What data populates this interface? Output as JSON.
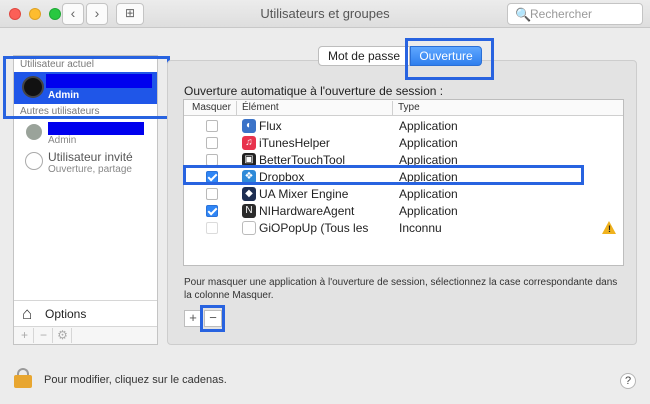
{
  "window": {
    "title": "Utilisateurs et groupes",
    "nav_back": "‹",
    "nav_forward": "›",
    "grid": "⊞",
    "search_placeholder": "Rechercher",
    "search_icon": "🔍"
  },
  "sidebar": {
    "current_header": "Utilisateur actuel",
    "current_user": {
      "name": "Admin",
      "role": ""
    },
    "others_header": "Autres utilisateurs",
    "other_user": {
      "role": "Admin"
    },
    "guest": {
      "name": "Utilisateur invité",
      "subtitle": "Ouverture, partage"
    },
    "options_label": "Options",
    "add": "+",
    "remove": "−",
    "gear": "⚙"
  },
  "tabs": [
    {
      "label": "Mot de passe",
      "selected": false
    },
    {
      "label": "Ouverture",
      "selected": true
    }
  ],
  "login_items": {
    "label": "Ouverture automatique à l'ouverture de session :",
    "columns": [
      "Masquer",
      "Élément",
      "Type"
    ],
    "rows": [
      {
        "hide": false,
        "name": "Flux",
        "type": "Application",
        "icon": "flux-icon",
        "color": "#3b73c8",
        "glyph": "◐"
      },
      {
        "hide": false,
        "name": "iTunesHelper",
        "type": "Application",
        "icon": "itunes-icon",
        "color": "#e8334d",
        "glyph": "♫"
      },
      {
        "hide": false,
        "name": "BetterTouchTool",
        "type": "Application",
        "icon": "bettertouchtool-icon",
        "color": "#222222",
        "glyph": "▣"
      },
      {
        "hide": true,
        "name": "Dropbox",
        "type": "Application",
        "icon": "dropbox-icon",
        "color": "#2e8ad8",
        "glyph": "❖"
      },
      {
        "hide": false,
        "name": "UA Mixer Engine",
        "type": "Application",
        "icon": "ua-mixer-icon",
        "color": "#1d2e52",
        "glyph": "◆"
      },
      {
        "hide": true,
        "name": "NIHardwareAgent",
        "type": "Application",
        "icon": "ni-hardware-icon",
        "color": "#2b2b2b",
        "glyph": "N"
      },
      {
        "hide": false,
        "name": "GiOPopUp (Tous les",
        "type": "Inconnu",
        "icon": "generic-file-icon",
        "color": "#ffffff",
        "glyph": "",
        "warning": true
      }
    ]
  },
  "hint": "Pour masquer une application à l'ouverture de session, sélectionnez la case correspondante dans la colonne Masquer.",
  "list_add": "+",
  "list_remove": "−",
  "footer": {
    "lock_text": "Pour modifier, cliquez sur le cadenas.",
    "help": "?"
  },
  "colors": {
    "accent": "#2f7fee",
    "highlight": "#2863e0",
    "redaction": "#0000ee"
  }
}
